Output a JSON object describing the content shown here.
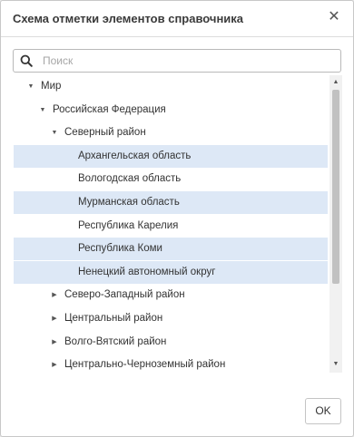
{
  "dialog": {
    "title": "Схема отметки элементов справочника",
    "close_glyph": "✕"
  },
  "search": {
    "placeholder": "Поиск",
    "value": ""
  },
  "tree": {
    "rows": [
      {
        "label": "Мир",
        "level": 0,
        "toggle": "expanded",
        "selected": false
      },
      {
        "label": "Российская Федерация",
        "level": 1,
        "toggle": "expanded",
        "selected": false
      },
      {
        "label": "Северный район",
        "level": 2,
        "toggle": "expanded",
        "selected": false
      },
      {
        "label": "Архангельская область",
        "level": 3,
        "toggle": "none",
        "selected": true
      },
      {
        "label": "Вологодская область",
        "level": 3,
        "toggle": "none",
        "selected": false
      },
      {
        "label": "Мурманская область",
        "level": 3,
        "toggle": "none",
        "selected": true
      },
      {
        "label": "Республика Карелия",
        "level": 3,
        "toggle": "none",
        "selected": false
      },
      {
        "label": "Республика Коми",
        "level": 3,
        "toggle": "none",
        "selected": true
      },
      {
        "label": "Ненецкий автономный округ",
        "level": 3,
        "toggle": "none",
        "selected": true
      },
      {
        "label": "Северо-Западный район",
        "level": 2,
        "toggle": "collapsed",
        "selected": false
      },
      {
        "label": "Центральный район",
        "level": 2,
        "toggle": "collapsed",
        "selected": false
      },
      {
        "label": "Волго-Вятский район",
        "level": 2,
        "toggle": "collapsed",
        "selected": false
      },
      {
        "label": "Центрально-Черноземный район",
        "level": 2,
        "toggle": "collapsed",
        "selected": false
      }
    ]
  },
  "footer": {
    "ok_label": "OK"
  },
  "colors": {
    "selected_row": "#dde8f6",
    "border": "#c8c8c8"
  }
}
